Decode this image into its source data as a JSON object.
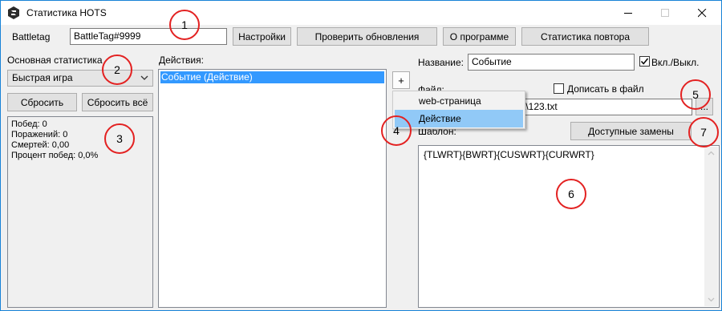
{
  "window": {
    "title": "Статистика HOTS",
    "icon": "hots-logo-icon"
  },
  "toolbar": {
    "battletag_label": "Battletag",
    "battletag_value": "BattleTag#9999",
    "settings_label": "Настройки",
    "check_updates_label": "Проверить обновления",
    "about_label": "О программе",
    "replay_stats_label": "Статистика повтора"
  },
  "left_panel": {
    "title": "Основная статистика",
    "mode_selected": "Быстрая игра",
    "reset_label": "Сбросить",
    "reset_all_label": "Сбросить всё",
    "stats": [
      "Побед: 0",
      "Поражений: 0",
      "Смертей: 0,00",
      "Процент побед: 0,0%"
    ]
  },
  "actions": {
    "title": "Действия:",
    "items": [
      "Событие (Действие)"
    ],
    "add_label": "+"
  },
  "add_menu": {
    "items": [
      {
        "label": "web-страница",
        "selected": false
      },
      {
        "label": "Действие",
        "selected": true
      }
    ]
  },
  "details": {
    "name_label": "Название:",
    "name_value": "Событие",
    "enabled_label": "Вкл./Выкл.",
    "enabled": true,
    "file_label": "Файл:",
    "file_value": "t\\123.txt",
    "append_label": "Дописать в файл",
    "append": false,
    "browse_label": "...",
    "template_label": "Шаблон:",
    "replacements_label": "Доступные замены",
    "template_value": "{TLWRT}{BWRT}{CUSWRT}{CURWRT}"
  },
  "markers": [
    "1",
    "2",
    "3",
    "4",
    "5",
    "6",
    "7"
  ],
  "colors": {
    "marker": "#e32121",
    "selection": "#3399ff",
    "menu_highlight": "#91c9f7",
    "window_border": "#1883d7"
  }
}
